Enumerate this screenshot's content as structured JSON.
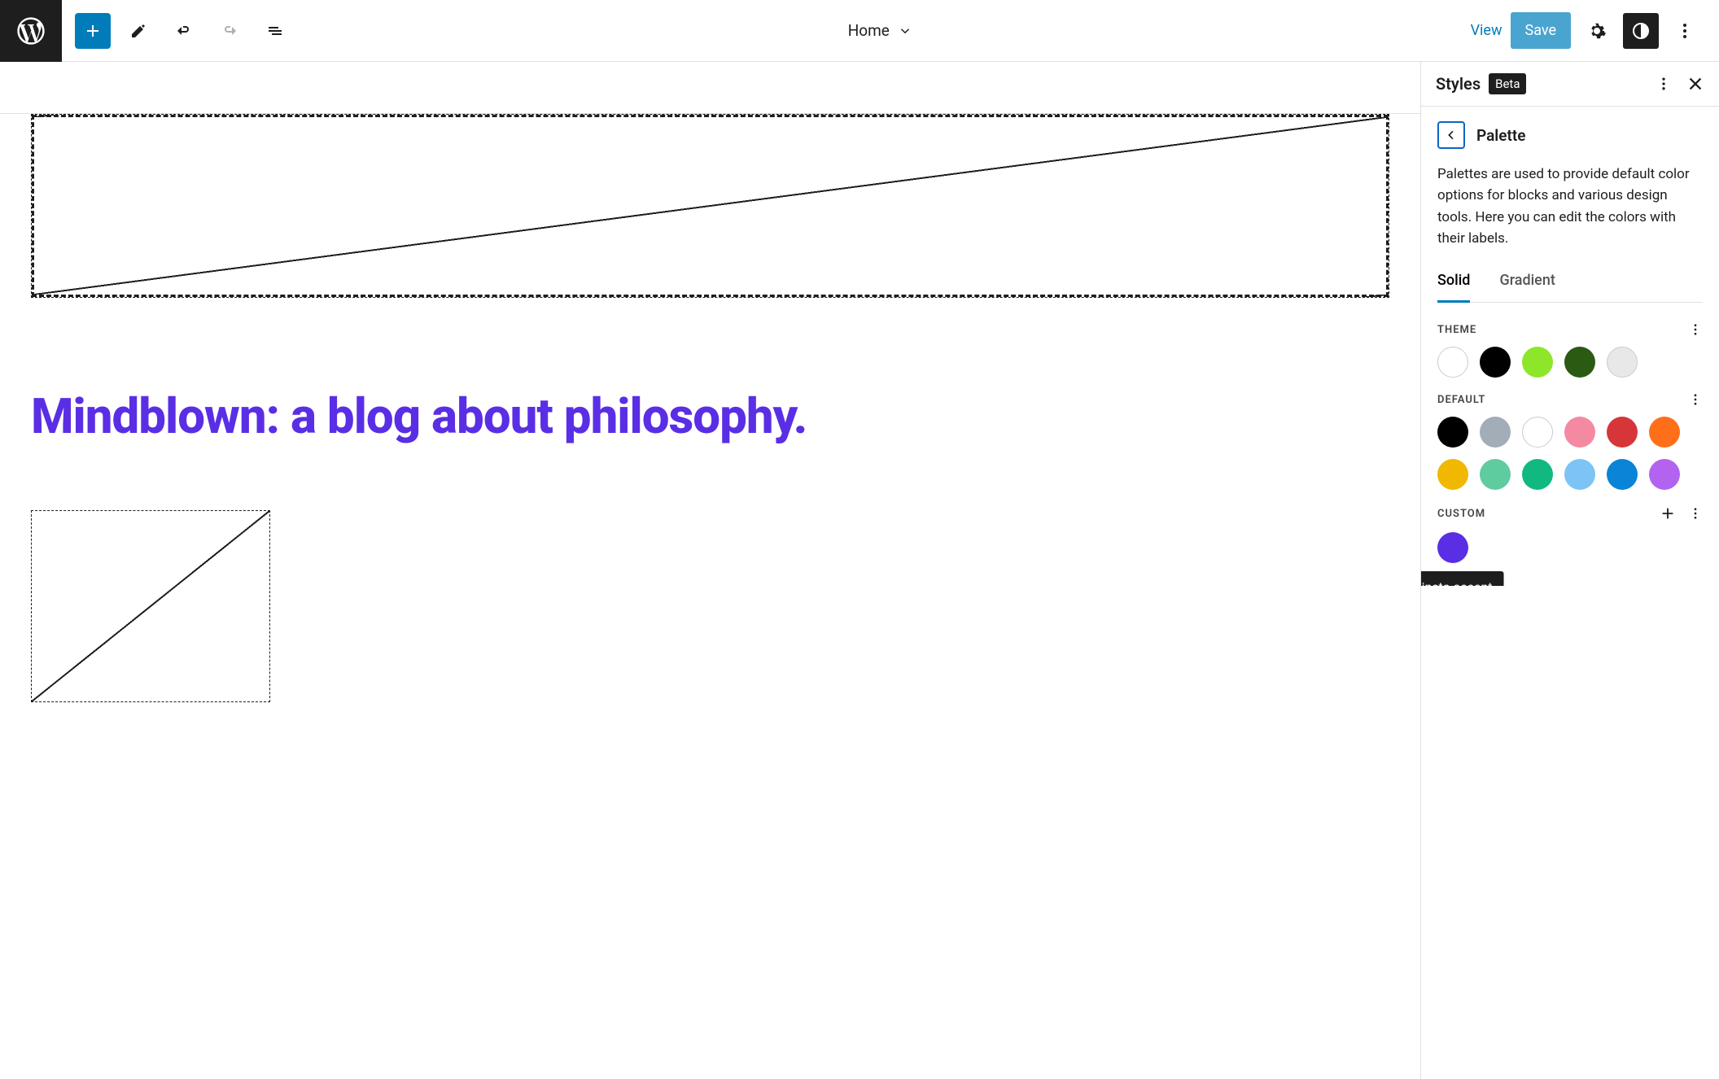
{
  "topbar": {
    "document_title": "Home",
    "view_label": "View",
    "save_label": "Save"
  },
  "sidebar": {
    "title": "Styles",
    "badge": "Beta",
    "panel_title": "Palette",
    "description": "Palettes are used to provide default color options for blocks and various design tools. Here you can edit the colors with their labels.",
    "tabs": {
      "solid": "Solid",
      "gradient": "Gradient"
    },
    "sections": {
      "theme": {
        "label": "Theme",
        "colors": [
          "#ffffff",
          "#000000",
          "#8ee62a",
          "#2b5a13",
          "#e8e8e8"
        ]
      },
      "default": {
        "label": "Default",
        "colors": [
          "#000000",
          "#a3adb8",
          "#ffffff",
          "#f48aa2",
          "#d63638",
          "#ff6f1a",
          "#f0b800",
          "#5fcca0",
          "#11b981",
          "#7bc4f5",
          "#0a84d6",
          "#b264f0"
        ]
      },
      "custom": {
        "label": "Custom",
        "colors": [
          "#5a2ee5"
        ],
        "tooltip": "Kinsta accent"
      }
    }
  },
  "canvas": {
    "heading": "Mindblown: a blog about philosophy."
  }
}
